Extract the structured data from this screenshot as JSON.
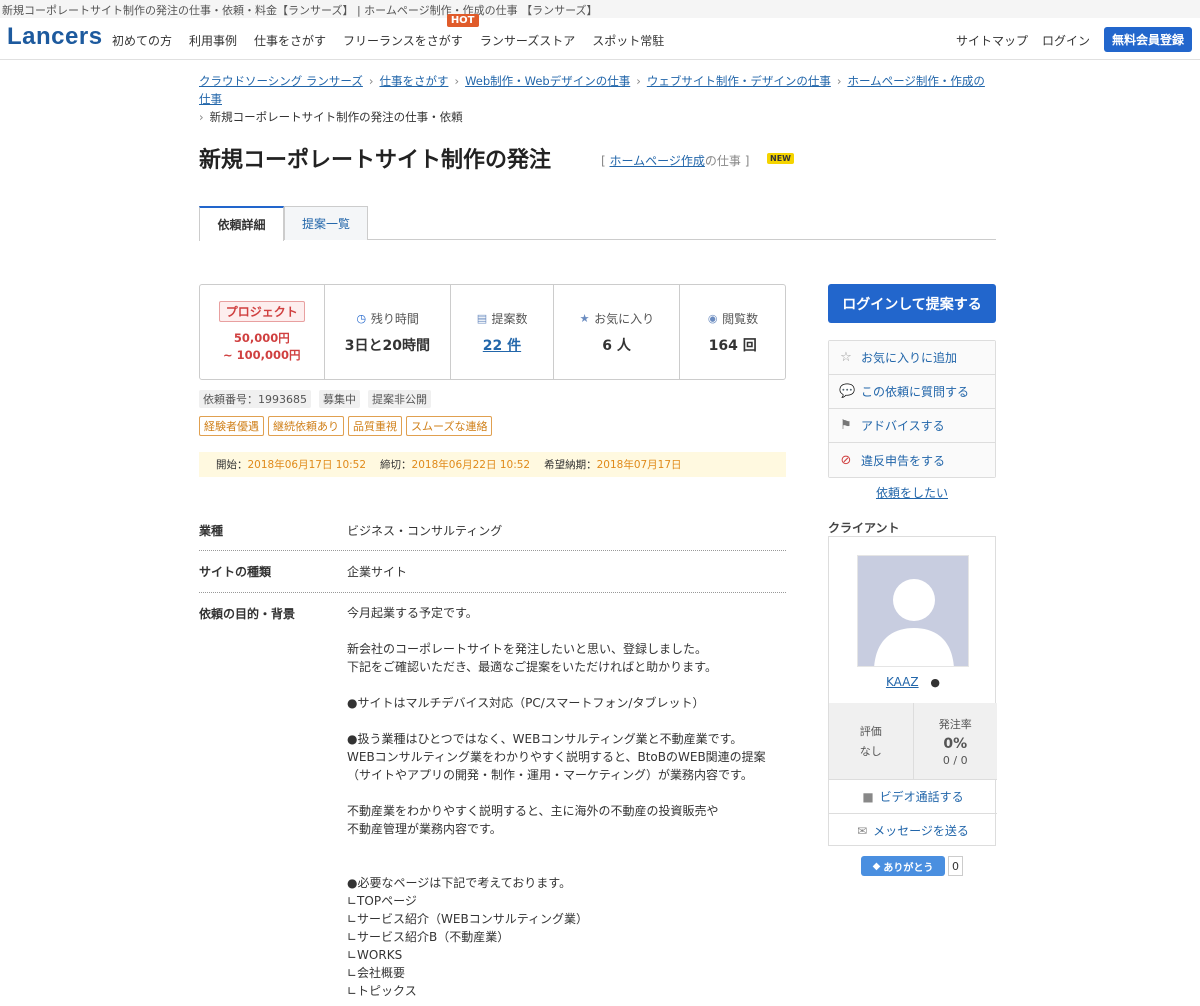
{
  "window": {
    "title": "新規コーポレートサイト制作の発注の仕事・依頼・料金【ランサーズ】 | ホームページ制作・作成の仕事 【ランサーズ】"
  },
  "header": {
    "logo": "Lancers",
    "nav": [
      "初めての方",
      "利用事例",
      "仕事をさがす",
      "フリーランスをさがす",
      "ランサーズストア",
      "スポット常駐"
    ],
    "hot_badge": "HOT",
    "right_links": [
      "サイトマップ",
      "ログイン"
    ],
    "register_button": "無料会員登録"
  },
  "breadcrumbs": {
    "items": [
      "クラウドソーシング ランサーズ",
      "仕事をさがす",
      "Web制作・Webデザインの仕事",
      "ウェブサイト制作・デザインの仕事",
      "ホームページ制作・作成の仕事"
    ],
    "current": "新規コーポレートサイト制作の発注の仕事・依頼"
  },
  "job": {
    "title": "新規コーポレートサイト制作の発注",
    "category_open": "[",
    "category_link": "ホームページ作成",
    "category_suffix": "の仕事 ]",
    "new_badge": "NEW"
  },
  "tabs": [
    "依頼詳細",
    "提案一覧"
  ],
  "stats": {
    "project_badge": "プロジェクト",
    "price_min": "50,000円",
    "price_max": "~ 100,000円",
    "remaining_label": "残り時間",
    "remaining_value": "3日と20時間",
    "proposals_label": "提案数",
    "proposals_value": "22 件",
    "favorites_label": "お気に入り",
    "favorites_value": "6 人",
    "views_label": "閲覧数",
    "views_value": "164 回"
  },
  "meta_tags": [
    "依頼番号：1993685",
    "募集中",
    "提案非公開"
  ],
  "feature_tags": [
    "経験者優遇",
    "継続依頼あり",
    "品質重視",
    "スムーズな連絡"
  ],
  "dates": {
    "start_label": "開始：",
    "start_value": "2018年06月17日 10:52",
    "deadline_label": "締切：",
    "deadline_value": "2018年06月22日 10:52",
    "delivery_label": "希望納期：",
    "delivery_value": "2018年07月17日"
  },
  "details": {
    "industry_label": "業種",
    "industry_value": "ビジネス・コンサルティング",
    "site_type_label": "サイトの種類",
    "site_type_value": "企業サイト",
    "purpose_label": "依頼の目的・背景",
    "body": [
      "今月起業する予定です。",
      "新会社のコーポレートサイトを発注したいと思い、登録しました。\n下記をご確認いただき、最適なご提案をいただければと助かります。",
      "●サイトはマルチデバイス対応（PC/スマートフォン/タブレット）",
      "●扱う業種はひとつではなく、WEBコンサルティング業と不動産業です。\nWEBコンサルティング業をわかりやすく説明すると、BtoBのWEB関連の提案\n（サイトやアプリの開発・制作・運用・マーケティング）が業務内容です。",
      "不動産業をわかりやすく説明すると、主に海外の不動産の投資販売や\n不動産管理が業務内容です。",
      "",
      "●必要なページは下記で考えております。\n∟TOPページ\n∟サービス紹介（WEBコンサルティング業）\n∟サービス紹介B（不動産業）\n∟WORKS\n∟会社概要\n∟トピックス"
    ]
  },
  "sidebar": {
    "cta": "ログインして提案する",
    "actions": [
      "お気に入りに追加",
      "この依頼に質問する",
      "アドバイスする",
      "違反申告をする"
    ],
    "request_link": "依頼をしたい",
    "client_heading": "クライアント",
    "client_name": "KAAZ",
    "rating_label": "評価",
    "rating_value": "なし",
    "order_rate_label": "発注率",
    "order_rate_value": "0%",
    "order_rate_count": "0 / 0",
    "video_call": "ビデオ通話する",
    "message": "メッセージを送る",
    "thanks_label": "ありがとう",
    "thanks_count": "0"
  },
  "colors": {
    "brand": "#2266cc",
    "link": "#2266aa",
    "price": "#d04040",
    "tag": "#e0a050"
  }
}
